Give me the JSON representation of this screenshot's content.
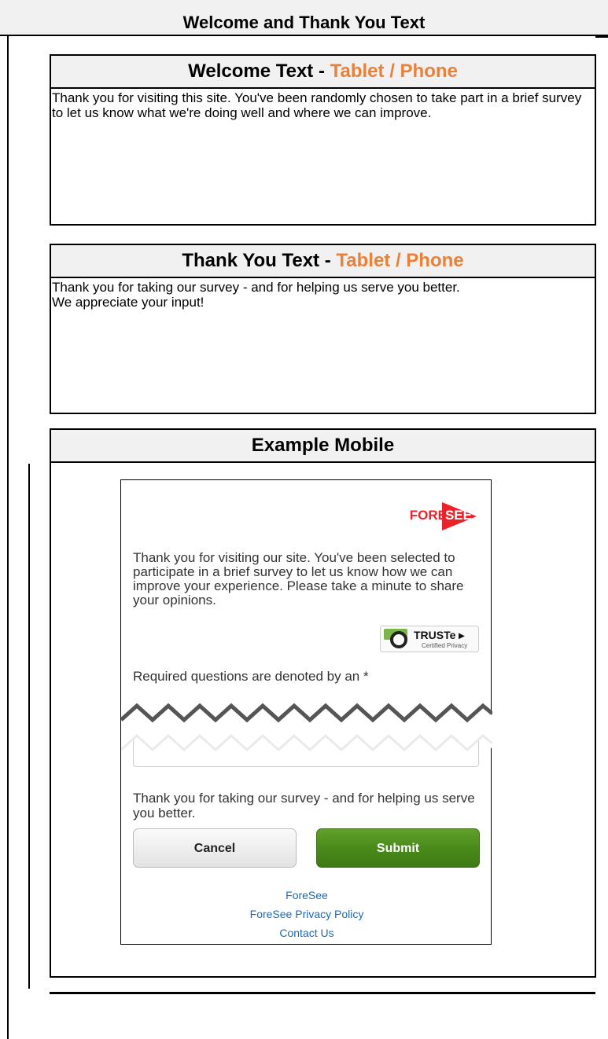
{
  "header": {
    "title": "Welcome and Thank You Text"
  },
  "welcome_panel": {
    "title_prefix": "Welcome Text - ",
    "title_accent": "Tablet / Phone",
    "body": "Thank you for visiting this site. You've been randomly chosen to take part in a brief survey to let us know what we're doing well and where we can improve."
  },
  "thanks_panel": {
    "title_prefix": "Thank You Text - ",
    "title_accent": "Tablet / Phone",
    "body": "Thank you for taking our survey - and for helping us serve you better.\nWe appreciate your input!"
  },
  "example_panel": {
    "title": "Example Mobile",
    "logo": {
      "left": "FORE",
      "right": "SEE"
    },
    "intro": "Thank you for visiting our site. You've been selected to participate in a brief survey to let us know how we can improve your experience. Please take a minute to share your opinions.",
    "truste": {
      "name": "TRUSTe ▸",
      "sub": "Certified Privacy"
    },
    "required_note": "Required questions are denoted by an *",
    "thanks": "Thank you for taking our survey - and for helping us serve you better.",
    "cancel_label": "Cancel",
    "submit_label": "Submit",
    "links": [
      "ForeSee",
      "ForeSee Privacy Policy",
      "Contact Us"
    ]
  },
  "colors": {
    "accent": "#e8813a",
    "brand_red": "#e8232a",
    "submit_green": "#4a8a1b",
    "link": "#1a6ab8"
  }
}
